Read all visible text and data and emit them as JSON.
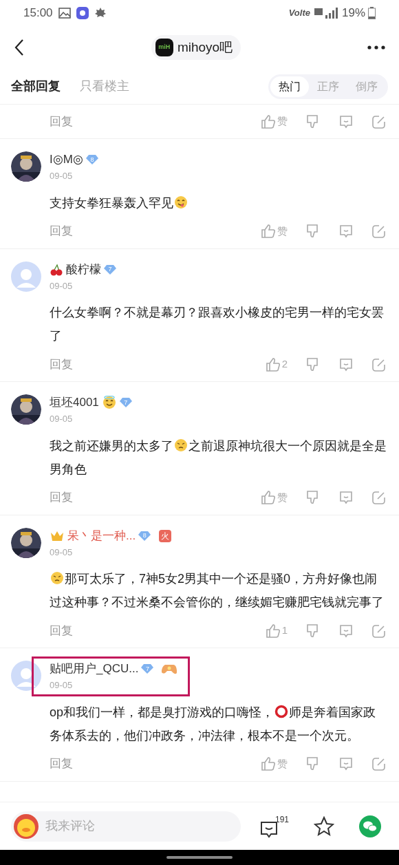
{
  "status_bar": {
    "time": "15:00",
    "network": "Volte",
    "battery": "19%"
  },
  "nav": {
    "title": "mihoyo吧",
    "logo_text": "miH"
  },
  "filter_tabs": [
    {
      "label": "全部回复",
      "selected": true
    },
    {
      "label": "只看楼主",
      "selected": false
    }
  ],
  "sort_tabs": [
    {
      "label": "热门",
      "selected": true
    },
    {
      "label": "正序",
      "selected": false
    },
    {
      "label": "倒序",
      "selected": false
    }
  ],
  "comments": [
    {
      "actions": {
        "reply": "回复",
        "like": "赞"
      }
    },
    {
      "user": {
        "name": "I◎M◎",
        "vip": false,
        "level": "8"
      },
      "avatar": {
        "kind": "picture"
      },
      "date": "09-05",
      "highlighted": false,
      "body": [
        {
          "kind": "text",
          "text": "支持女拳狂暴轰入罕见"
        },
        {
          "kind": "yum"
        }
      ],
      "actions": {
        "reply": "回复",
        "like": "赞"
      }
    },
    {
      "user": {
        "name": "酸柠檬",
        "vip": false,
        "prefix_icon": {
          "kind": "cherry"
        },
        "level": "7"
      },
      "avatar": {
        "kind": "default"
      },
      "date": "09-05",
      "highlighted": false,
      "body": [
        {
          "kind": "text",
          "text": "什么女拳啊？不就是幕刃？跟喜欢小橡皮的宅男一样的宅女罢了"
        }
      ],
      "actions": {
        "reply": "回复",
        "like": "2"
      }
    },
    {
      "user": {
        "name": "垣坯4001",
        "vip": false,
        "suffix_icon": {
          "kind": "halo"
        },
        "level": "7"
      },
      "avatar": {
        "kind": "picture"
      },
      "date": "09-05",
      "highlighted": false,
      "body": [
        {
          "kind": "text",
          "text": "我之前还嫌男的太多了"
        },
        {
          "kind": "wince"
        },
        {
          "kind": "text",
          "text": "之前退原神坑很大一个原因就是全是男角色"
        }
      ],
      "actions": {
        "reply": "回复",
        "like": "赞"
      }
    },
    {
      "user": {
        "name": "呆丶是一种...",
        "vip": true,
        "prefix_icon": {
          "kind": "crown"
        },
        "level": "8",
        "badges": [
          {
            "kind": "text",
            "text": "火"
          }
        ]
      },
      "avatar": {
        "kind": "picture"
      },
      "date": "09-05",
      "highlighted": false,
      "body": [
        {
          "kind": "wince"
        },
        {
          "kind": "text",
          "text": "那可太乐了，7神5女2男其中一个还是骚0，方舟好像也闹过这种事？不过米桑不会管你的，继续媚宅赚肥宅钱就完事了"
        }
      ],
      "actions": {
        "reply": "回复",
        "like": "1"
      }
    },
    {
      "user": {
        "name": "贴吧用户_QCU...",
        "vip": false,
        "level": "7",
        "badges": [
          {
            "kind": "gamepad"
          }
        ]
      },
      "avatar": {
        "kind": "default"
      },
      "date": "09-05",
      "highlighted": true,
      "body": [
        {
          "kind": "text",
          "text": "op和我们一样，都是臭打游戏的口嗨怪，"
        },
        {
          "kind": "ring"
        },
        {
          "kind": "text",
          "text": "师是奔着国家政务体系去的，他们冲政务，冲法律，根本不是一个次元。"
        }
      ],
      "actions": {
        "reply": "回复",
        "like": "赞"
      }
    }
  ],
  "bottom_bar": {
    "placeholder": "我来评论",
    "comment_count": "191"
  }
}
